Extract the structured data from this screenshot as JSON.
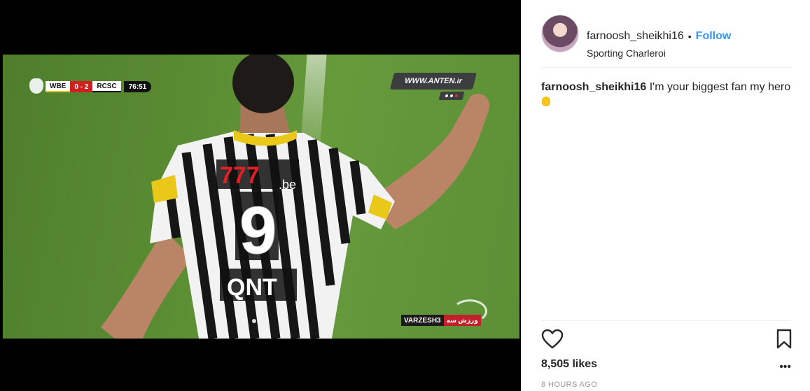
{
  "video": {
    "scoreboard": {
      "home": "WBE",
      "score": "0 - 2",
      "away": "RCSC",
      "clock": "76:51"
    },
    "watermark": "WWW.ANTEN.ir",
    "channel": {
      "name": "VARZESH3",
      "sub": "ورزش سه"
    },
    "jersey": {
      "sponsor": "777",
      "sponsor_suffix": ".be",
      "number": "9",
      "back_sponsor": "QNT"
    }
  },
  "post": {
    "username": "farnoosh_sheikhi16",
    "separator": "•",
    "follow_label": "Follow",
    "location": "Sporting Charleroi",
    "caption": {
      "username": "farnoosh_sheikhi16",
      "text": "I'm your biggest fan my hero"
    },
    "likes": "8,505 likes",
    "timestamp": "8 HOURS AGO",
    "icons": {
      "like": "heart-icon",
      "save": "bookmark-icon",
      "more": "more-options-icon"
    }
  },
  "colors": {
    "link": "#3897f0",
    "text": "#262626",
    "muted": "#999999"
  }
}
